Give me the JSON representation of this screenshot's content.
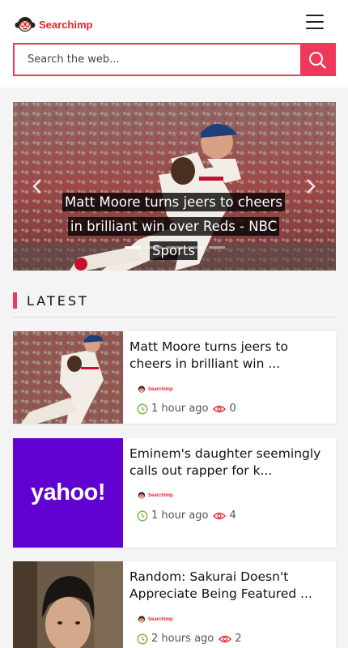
{
  "app": {
    "brand": "Searchimp"
  },
  "search": {
    "placeholder": "Search the web..."
  },
  "hero": {
    "caption": "Matt Moore turns jeers to cheers in brilliant win over Reds - NBC Sports",
    "slide_count": 5,
    "active_slide": 1
  },
  "section": {
    "title": "LATEST"
  },
  "articles": [
    {
      "title": "Matt Moore turns jeers to cheers in brilliant win ...",
      "source": "Searchimp",
      "time": "1 hour ago",
      "views": "0",
      "thumb": "baseball-pitcher"
    },
    {
      "title": "Eminem's daughter seemingly calls out rapper for k...",
      "source": "Searchimp",
      "time": "1 hour ago",
      "views": "4",
      "thumb": "yahoo-logo",
      "thumb_text": "yahoo!"
    },
    {
      "title": "Random: Sakurai Doesn't Appreciate Being Featured ...",
      "source": "Searchimp",
      "time": "2 hours ago",
      "views": "2",
      "thumb": "person-portrait"
    }
  ],
  "colors": {
    "accent": "#f0385a",
    "brand_red": "#e8222d",
    "clock_green": "#7cb342",
    "yahoo_purple": "#6001d2"
  }
}
